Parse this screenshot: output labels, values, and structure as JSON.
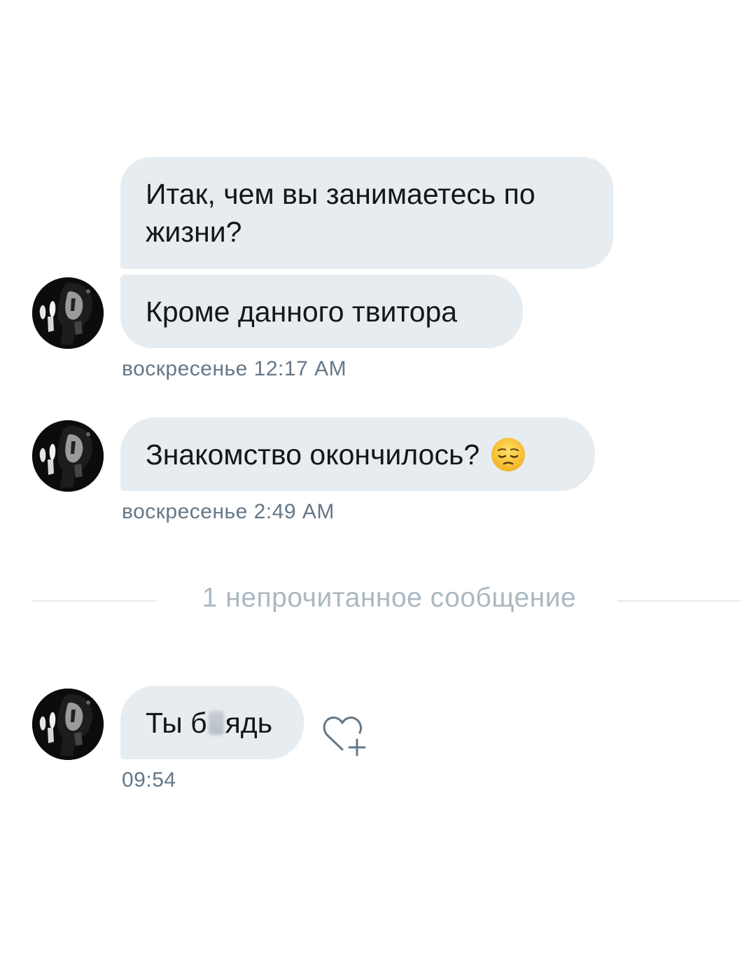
{
  "messages": [
    {
      "group": 1,
      "bubbles": [
        {
          "text": "Итак, чем вы занимаетесь по\nжизни?"
        },
        {
          "text": "Кроме данного твитора"
        }
      ],
      "timestamp": "воскресенье 12:17 AM"
    },
    {
      "group": 2,
      "bubbles": [
        {
          "text": "Знакомство окончилось?",
          "emoji": "pensive-face"
        }
      ],
      "timestamp": "воскресенье 2:49 AM"
    },
    {
      "group": 3,
      "bubbles": [
        {
          "text_before": "Ты б",
          "text_after": "ядь",
          "censored": true
        }
      ],
      "timestamp": "09:54"
    }
  ],
  "divider": {
    "label": "1 непрочитанное сообщение"
  },
  "icons": {
    "avatar": "avatar-image",
    "like": "heart-plus-icon",
    "emoji": "pensive-face-emoji"
  },
  "colors": {
    "bubble_bg": "#e6ecf0",
    "timestamp": "#657786",
    "divider_text": "#aab8c2",
    "background": "#ffffff"
  }
}
